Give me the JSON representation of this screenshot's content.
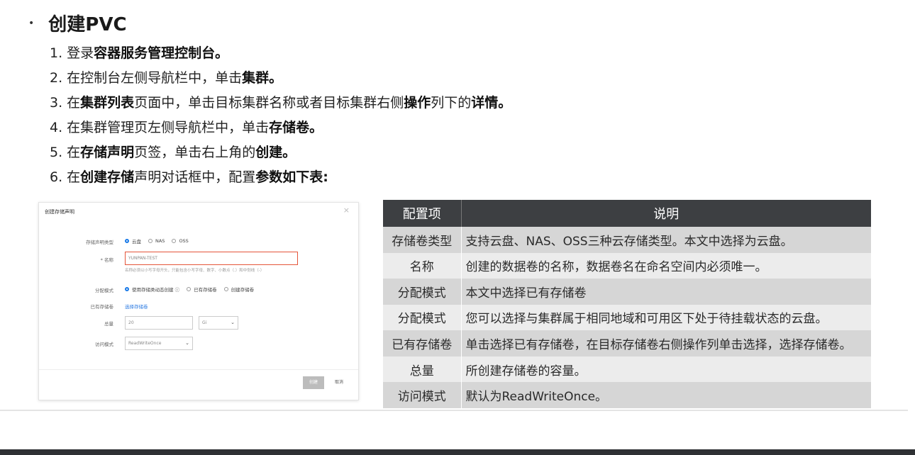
{
  "heading": {
    "bullet": "•",
    "title": "创建PVC"
  },
  "steps": [
    [
      {
        "t": "1. 登录"
      },
      {
        "t": "容器服务管理控制台。",
        "b": true
      }
    ],
    [
      {
        "t": "2. 在控制台左侧导航栏中，单击"
      },
      {
        "t": "集群。",
        "b": true
      }
    ],
    [
      {
        "t": "3. 在"
      },
      {
        "t": "集群列表",
        "b": true
      },
      {
        "t": "页面中，单击目标集群名称或者目标集群右侧"
      },
      {
        "t": "操作",
        "b": true
      },
      {
        "t": "列下的"
      },
      {
        "t": "详情。",
        "b": true
      }
    ],
    [
      {
        "t": "4. 在集群管理页左侧导航栏中，单击"
      },
      {
        "t": "存储卷。",
        "b": true
      }
    ],
    [
      {
        "t": "5. 在"
      },
      {
        "t": "存储声明",
        "b": true
      },
      {
        "t": "页签，单击右上角的"
      },
      {
        "t": "创建。",
        "b": true
      }
    ],
    [
      {
        "t": "6. 在"
      },
      {
        "t": "创建存储",
        "b": true
      },
      {
        "t": "声明对话框中，配置"
      },
      {
        "t": "参数如下表:",
        "b": true
      }
    ]
  ],
  "dialog": {
    "title": "创建存储声明",
    "close": "×",
    "storage_type_label": "存储声明类型",
    "storage_options": [
      "云盘",
      "NAS",
      "OSS"
    ],
    "name_label": "* 名称",
    "name_value": "YUNPAN-TEST",
    "name_hint": "名称必须以小写字母开头，只能包含小写字母、数字、小数点（.）和中划线（-）",
    "alloc_label": "分配模式",
    "alloc_options": [
      "使用存储类动态创建 ⓘ",
      "已有存储卷",
      "创建存储卷"
    ],
    "existing_label": "已有存储卷",
    "existing_link": "选择存储卷",
    "capacity_label": "总量",
    "capacity_value": "20",
    "capacity_unit": "Gi",
    "access_label": "访问模式",
    "access_value": "ReadWriteOnce",
    "create_button": "创建",
    "cancel_button": "取消"
  },
  "table": {
    "headers": [
      "配置项",
      "说明"
    ],
    "rows": [
      [
        "存储卷类型",
        "支持云盘、NAS、OSS三种云存储类型。本文中选择为云盘。"
      ],
      [
        "名称",
        "创建的数据卷的名称，数据卷名在命名空间内必须唯一。"
      ],
      [
        "分配模式",
        "本文中选择已有存储卷"
      ],
      [
        "分配模式",
        "您可以选择与集群属于相同地域和可用区下处于待挂载状态的云盘。"
      ],
      [
        "已有存储卷",
        "单击选择已有存储卷，在目标存储卷右侧操作列单击选择，选择存储卷。"
      ],
      [
        "总量",
        "所创建存储卷的容量。"
      ],
      [
        "访问模式",
        "默认为ReadWriteOnce。"
      ]
    ]
  },
  "colors": {
    "table_header": "#3d3f42",
    "row_odd": "#d6d6d6",
    "row_even": "#ececec",
    "accent": "#1a7ae8"
  }
}
